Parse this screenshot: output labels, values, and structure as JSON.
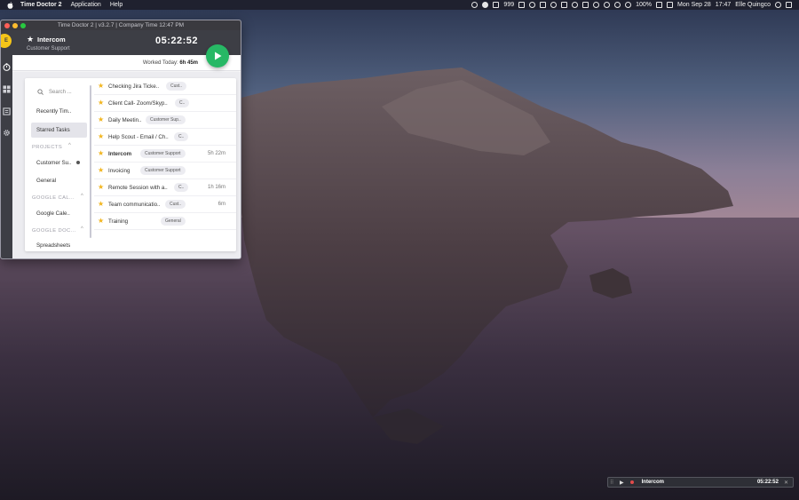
{
  "menubar": {
    "app_name": "Time Doctor 2",
    "menus": [
      "Application",
      "Help"
    ],
    "status_text": "999",
    "battery": "100%",
    "date": "Mon Sep 28",
    "time": "17:47",
    "user": "Elle Quingco"
  },
  "window": {
    "title": "Time Doctor 2 | v3.2.7 | Company Time 12:47 PM",
    "avatar_initial": "E",
    "current_task": "Intercom",
    "current_project": "Customer Support",
    "timer": "05:22:52",
    "worked_today_label": "Worked Today:",
    "worked_today_value": "6h 45m"
  },
  "sidebar": {
    "search_placeholder": "Search ...",
    "items": [
      {
        "label": "Recently Tim.."
      },
      {
        "label": "Starred Tasks"
      }
    ],
    "projects_header": "PROJECTS",
    "projects": [
      {
        "label": "Customer Su.."
      },
      {
        "label": "General"
      }
    ],
    "google_cal_header": "GOOGLE CAL...",
    "google_cal_items": [
      {
        "label": "Google Cale.."
      }
    ],
    "google_doc_header": "GOOGLE DOC...",
    "google_doc_items": [
      {
        "label": "Spreadsheets"
      }
    ]
  },
  "tasks": [
    {
      "name": "Checking Jira Ticke..",
      "chip": "Cust..",
      "duration": ""
    },
    {
      "name": "Client Call- Zoom/Skyp..",
      "chip": "C..",
      "duration": ""
    },
    {
      "name": "Daily Meetin..",
      "chip": "Customer Sup..",
      "duration": ""
    },
    {
      "name": "Help Scout - Email / Ch..",
      "chip": "C..",
      "duration": ""
    },
    {
      "name": "Intercom",
      "chip": "Customer Support",
      "duration": "5h 22m"
    },
    {
      "name": "Invoicing",
      "chip": "Customer Support",
      "duration": ""
    },
    {
      "name": "Remote Session with a..",
      "chip": "C..",
      "duration": "1h 16m"
    },
    {
      "name": "Team communicatio..",
      "chip": "Cust..",
      "duration": "6m"
    },
    {
      "name": "Training",
      "chip": "General",
      "duration": ""
    }
  ],
  "mini_widget": {
    "task": "Intercom",
    "timer": "05:22:52"
  },
  "colors": {
    "accent_green": "#27b865",
    "star_yellow": "#f2b51e",
    "header_dark": "#3d3e45"
  }
}
